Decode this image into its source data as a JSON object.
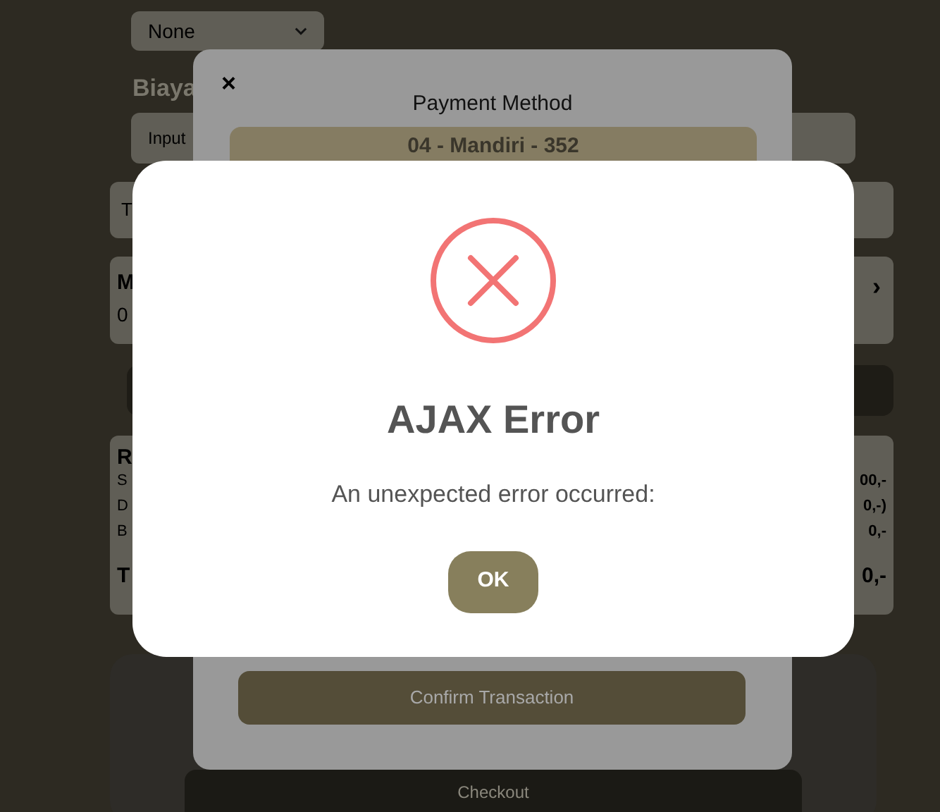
{
  "background": {
    "select": {
      "value": "None"
    },
    "section_heading": "Biaya",
    "input": {
      "placeholder": "Input"
    },
    "row_1": {
      "text": "T"
    },
    "row_2": {
      "title": "M",
      "value": "0",
      "chevron": "›"
    },
    "summary": {
      "title": "R",
      "lines": [
        {
          "label": "S",
          "value": "00,-"
        },
        {
          "label": "D",
          "value": "0,-)"
        },
        {
          "label": "B",
          "value": "0,-"
        }
      ],
      "total": {
        "label": "T",
        "value": "0,-"
      }
    },
    "checkout_button": "Checkout"
  },
  "payment_modal": {
    "close": "×",
    "title": "Payment Method",
    "selected_method": "04 - Mandiri - 352",
    "confirm_button": "Confirm Transaction"
  },
  "alert": {
    "title": "AJAX Error",
    "message": "An unexpected error occurred:",
    "ok_button": "OK"
  }
}
